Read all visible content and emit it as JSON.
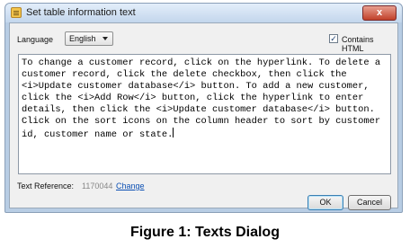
{
  "window": {
    "title": "Set table information text",
    "close_glyph": "x",
    "icon": "app-icon"
  },
  "language": {
    "label": "Language",
    "selected": "English"
  },
  "contains_html": {
    "label": "Contains HTML",
    "checked": true,
    "check_glyph": "✓"
  },
  "body_text": "To change a customer record, click on the hyperlink. To delete a customer record, click the delete checkbox, then click the <i>Update customer database</i> button. To add a new customer, click the <i>Add Row</i> button, click the hyperlink to enter details, then click the <i>Update customer database</i> button. Click on the sort icons on the column header to sort by customer id, customer name or state.",
  "text_reference": {
    "label": "Text Reference:",
    "value": "1170044",
    "change_link": "Change"
  },
  "buttons": {
    "ok": "OK",
    "cancel": "Cancel"
  },
  "caption": "Figure 1: Texts Dialog"
}
